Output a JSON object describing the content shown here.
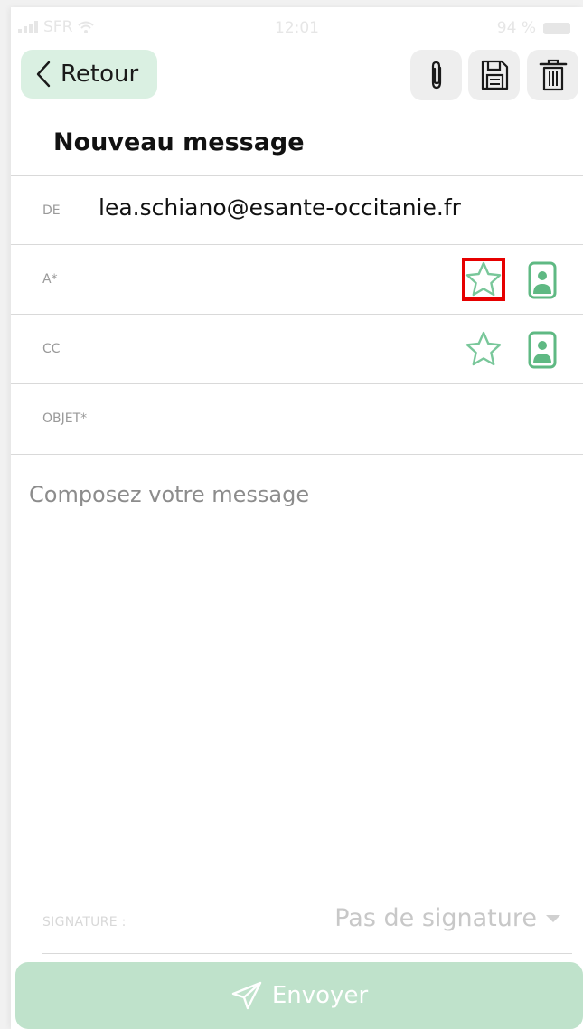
{
  "status_bar": {
    "carrier": "SFR",
    "time": "12:01",
    "battery": "94 %"
  },
  "header": {
    "back_label": "Retour",
    "title": "Nouveau message"
  },
  "form": {
    "from": {
      "label": "DE",
      "value": "lea.schiano@esante-occitanie.fr"
    },
    "to": {
      "label": "A*"
    },
    "cc": {
      "label": "CC"
    },
    "subject": {
      "label": "OBJET*"
    },
    "body": {
      "placeholder": "Composez votre message"
    }
  },
  "signature": {
    "label": "SIGNATURE :",
    "selected": "Pas de signature"
  },
  "send": {
    "label": "Envoyer"
  },
  "colors": {
    "accent": "#79c79a",
    "back_bg": "#daf0e2",
    "send_bg": "#bfe2cb",
    "highlight": "#e60000"
  }
}
